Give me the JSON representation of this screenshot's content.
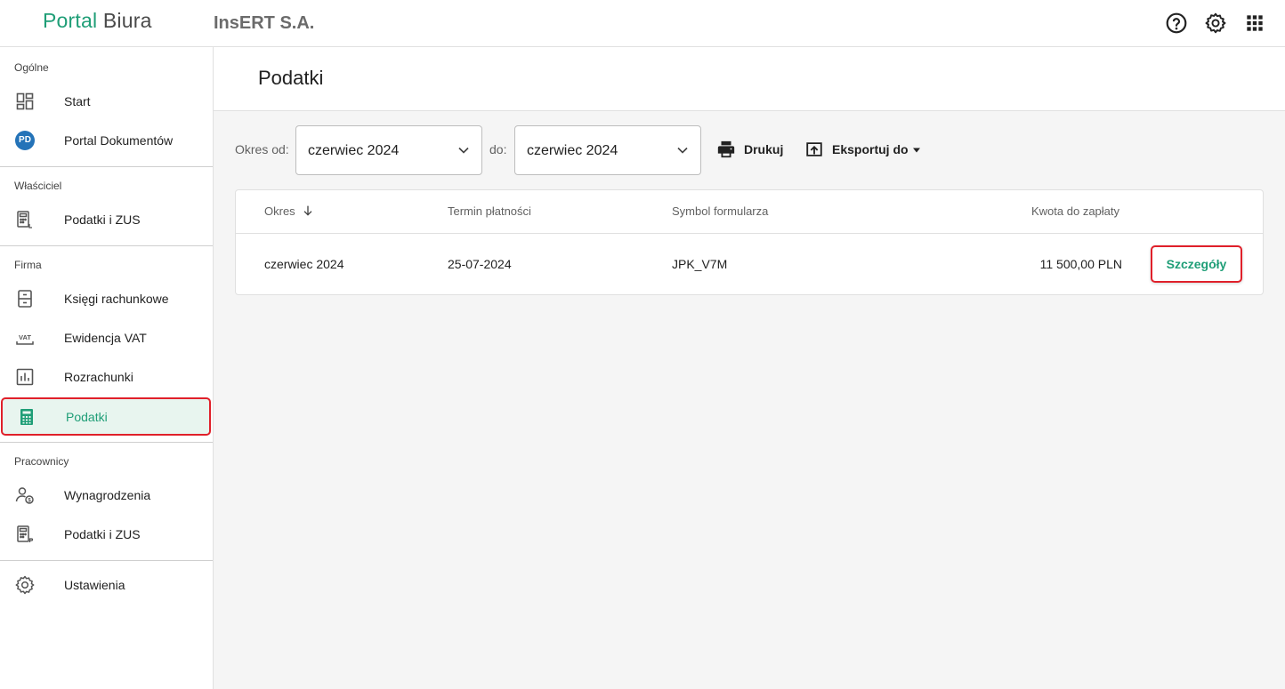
{
  "header": {
    "logo_part1": "Portal",
    "logo_part2": "Biura",
    "company": "InsERT S.A.",
    "icons": [
      "help-icon",
      "settings-icon",
      "apps-grid-icon"
    ]
  },
  "sidebar": {
    "sections": {
      "general": "Ogólne",
      "owner": "Właściciel",
      "company": "Firma",
      "employees": "Pracownicy"
    },
    "items": {
      "start": "Start",
      "portal_docs": "Portal Dokumentów",
      "portal_docs_badge": "PD",
      "owner_taxes": "Podatki i ZUS",
      "ledgers": "Księgi rachunkowe",
      "vat": "Ewidencja VAT",
      "settlements": "Rozrachunki",
      "taxes": "Podatki",
      "salaries": "Wynagrodzenia",
      "emp_taxes": "Podatki i ZUS",
      "settings": "Ustawienia"
    },
    "active_item": "Podatki"
  },
  "page": {
    "title": "Podatki"
  },
  "filters": {
    "from_label": "Okres od:",
    "from_value": "czerwiec 2024",
    "to_label": "do:",
    "to_value": "czerwiec 2024",
    "print_label": "Drukuj",
    "export_label": "Eksportuj do"
  },
  "table": {
    "columns": [
      "Okres",
      "Termin płatności",
      "Symbol formularza",
      "Kwota do zapłaty"
    ],
    "rows": [
      {
        "period": "czerwiec 2024",
        "due_date": "25-07-2024",
        "form_symbol": "JPK_V7M",
        "amount": "11 500,00 PLN",
        "action": "Szczegóły"
      }
    ]
  },
  "colors": {
    "brand_green": "#1f9e77",
    "highlight_red": "#e0202a",
    "badge_blue": "#2473b8"
  }
}
